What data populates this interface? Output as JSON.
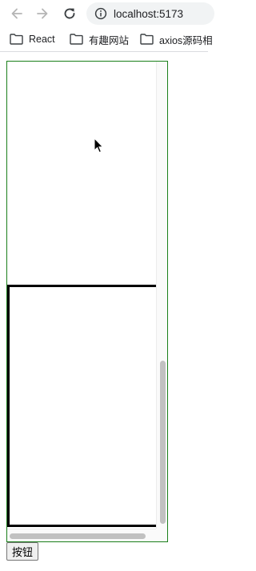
{
  "browser": {
    "back_icon": "arrow-left-icon",
    "forward_icon": "arrow-right-icon",
    "reload_icon": "reload-icon",
    "info_icon": "info-icon",
    "url": "localhost:5173"
  },
  "bookmarks": [
    {
      "label": "React",
      "icon": "folder-icon"
    },
    {
      "label": "有趣网站",
      "icon": "folder-icon"
    },
    {
      "label": "axios源码相",
      "icon": "folder-icon"
    }
  ],
  "page": {
    "button_label": "按钮",
    "scroll_box": {
      "border_color": "#1a7f1a",
      "inner_border_color": "#000000",
      "vertical_thumb_fraction": 0.36,
      "vertical_thumb_start": 0.64,
      "horizontal_thumb_fraction": 0.93
    }
  }
}
